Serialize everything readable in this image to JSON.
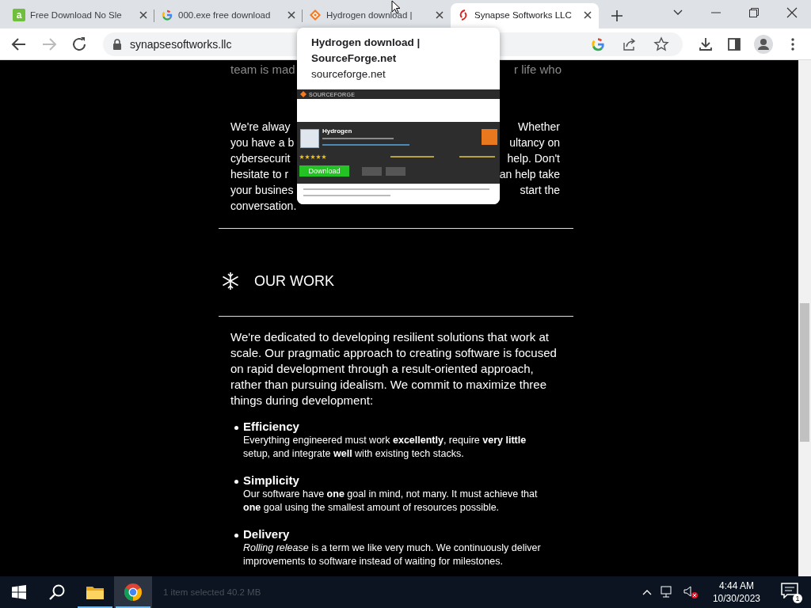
{
  "tabs": [
    {
      "kind": "letter",
      "letter": "a",
      "title": "Free Download No Sle",
      "selected": false
    },
    {
      "kind": "google",
      "title": "000.exe free download",
      "selected": false
    },
    {
      "kind": "diamond",
      "title": "Hydrogen download |",
      "selected": false
    },
    {
      "kind": "swirl",
      "title": "Synapse Softworks LLC",
      "selected": true
    }
  ],
  "address": "synapsesoftworks.llc",
  "hover_card": {
    "title": "Hydrogen download | SourceForge.net",
    "domain": "sourceforge.net",
    "preview": {
      "logo": "SOURCEFORGE",
      "project": "Hydrogen",
      "stars": 5,
      "button": "Download"
    }
  },
  "page": {
    "faded_line": {
      "left": "team is mad",
      "right": "r life who"
    },
    "covered_lines": [
      {
        "left": "We're alway",
        "right": "Whether"
      },
      {
        "left": "you have a b",
        "right": "ultancy on"
      },
      {
        "left": "cybersecurit",
        "right": "help. Don't"
      },
      {
        "left": "hesitate to r",
        "right": "an help take"
      },
      {
        "left": "your busines",
        "right": "start the"
      },
      {
        "left": "conversation."
      }
    ],
    "section": {
      "heading": "OUR WORK",
      "paragraph": "We're dedicated to developing resilient solutions that work at scale. Our pragmatic approach to creating software is focused on rapid development through a result-oriented approach, rather than pursuing idealism. We commit to maximize three things during development:",
      "items": [
        {
          "title": "Efficiency",
          "text": "Everything engineered must work **excellently**, require **very little** setup, and integrate **well** with existing tech stacks."
        },
        {
          "title": "Simplicity",
          "text": "Our software have **one** goal in mind, not many. It must achieve that **one** goal using the smallest amount of resources possible."
        },
        {
          "title": "Delivery",
          "text": "*Rolling release* is a term we like very much. We continuously deliver improvements to software instead of waiting for milestones."
        }
      ]
    }
  },
  "taskbar": {
    "ghost_status": "1 item selected  40.2 MB",
    "apps": [
      {
        "kind": "folder",
        "selected": false
      },
      {
        "kind": "chrome",
        "selected": true
      }
    ],
    "time": "4:44 AM",
    "date": "10/30/2023",
    "notifications": "1"
  }
}
